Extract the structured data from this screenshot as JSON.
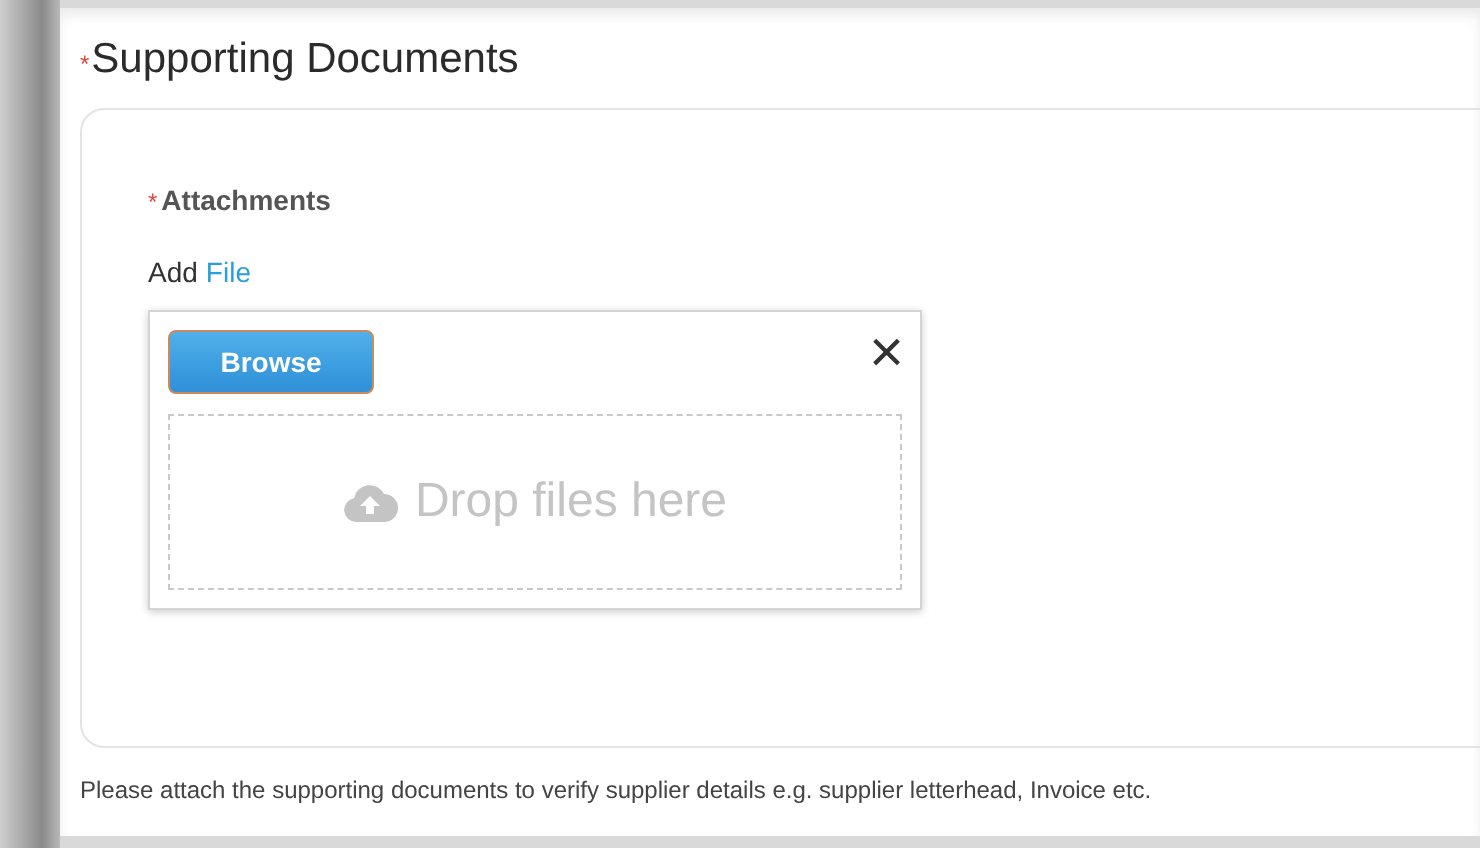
{
  "section": {
    "required_mark": "*",
    "title": "Supporting Documents"
  },
  "attachments": {
    "required_mark": "*",
    "label": "Attachments",
    "add_prefix": "Add",
    "add_link": "File"
  },
  "uploader": {
    "browse_button": "Browse",
    "close_symbol": "×",
    "dropzone_text": "Drop files here"
  },
  "help_text": "Please attach the supporting documents to verify supplier details e.g. supplier letterhead, Invoice etc."
}
